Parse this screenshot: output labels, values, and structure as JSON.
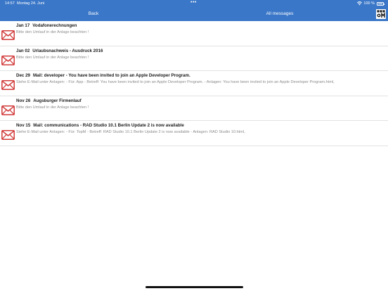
{
  "status_bar": {
    "time": "14:57",
    "date": "Montag 24. Juni",
    "dots": "•••",
    "battery_text": "100 %",
    "wifi_icon": "wifi-icon",
    "battery_icon": "battery-icon"
  },
  "nav": {
    "back_label": "Back",
    "title": "All messages",
    "logo_icon": "company-logo"
  },
  "colors": {
    "bar": "#3a77c8",
    "mail_icon": "#d23a3a",
    "preview_text": "#8c8c8c"
  },
  "messages": [
    {
      "date": "Jan 17",
      "subject": "Vodafonerechnungen",
      "preview": "Bitte den Umlauf in der Anlage beachten !",
      "icon": "mail-icon"
    },
    {
      "date": "Jan 02",
      "subject": "Urlaubsnachweis - Ausdruck 2016",
      "preview": "Bitte den Umlauf in der Anlage beachten !",
      "icon": "mail-icon"
    },
    {
      "date": "Dec 29",
      "subject": "Mail: developer - You have been invited to join an Apple Developer Program.",
      "preview": "Siehe E-Mail unter Anlagen: - Für: App - Betreff: You have been invited to join an Apple Developer Program. - Anlagen: You have been invited to join an Apple Developer Program.html,",
      "icon": "mail-icon"
    },
    {
      "date": "Nov 26",
      "subject": "Augsburger Firmenlauf",
      "preview": "Bitte den Umlauf in der Anlage beachten !",
      "icon": "mail-icon"
    },
    {
      "date": "Nov 15",
      "subject": "Mail: communications - RAD Studio 10.1 Berlin Update 2 is now available",
      "preview": "Siehe E-Mail unter Anlagen: - Für: TopM - Betreff: RAD Studio 10.1 Berlin Update 2 is now available - Anlagen: RAD Studio 10.html,",
      "icon": "mail-icon"
    }
  ]
}
